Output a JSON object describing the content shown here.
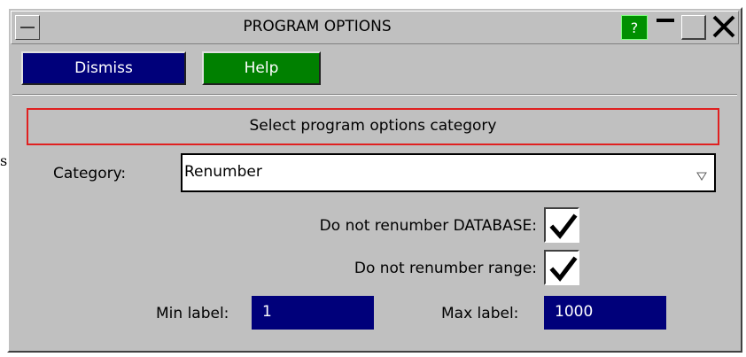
{
  "window": {
    "title": "PROGRAM OPTIONS",
    "help_label": "?",
    "close_glyph": "✕"
  },
  "toolbar": {
    "dismiss_label": "Dismiss",
    "help_label": "Help"
  },
  "header": {
    "text": "Select program options category"
  },
  "category": {
    "label": "Category:",
    "value": "Renumber"
  },
  "options": [
    {
      "label": "Do not renumber DATABASE:",
      "checked": true
    },
    {
      "label": "Do not renumber range:",
      "checked": true
    }
  ],
  "range": {
    "min_label": "Min label:",
    "min_value": "1",
    "max_label": "Max label:",
    "max_value": "1000"
  },
  "stray_text": "s",
  "colors": {
    "panel": "#c0c0c0",
    "dismiss": "#00007a",
    "help": "#008000",
    "field": "#00007a",
    "header_border": "#e02020"
  },
  "icons": {
    "system_menu": "system-menu-icon",
    "help": "help-icon",
    "minimize": "minimize-icon",
    "maximize": "maximize-icon",
    "close": "close-icon",
    "dropdown": "dropdown-arrow-icon",
    "check": "checkmark-icon"
  }
}
